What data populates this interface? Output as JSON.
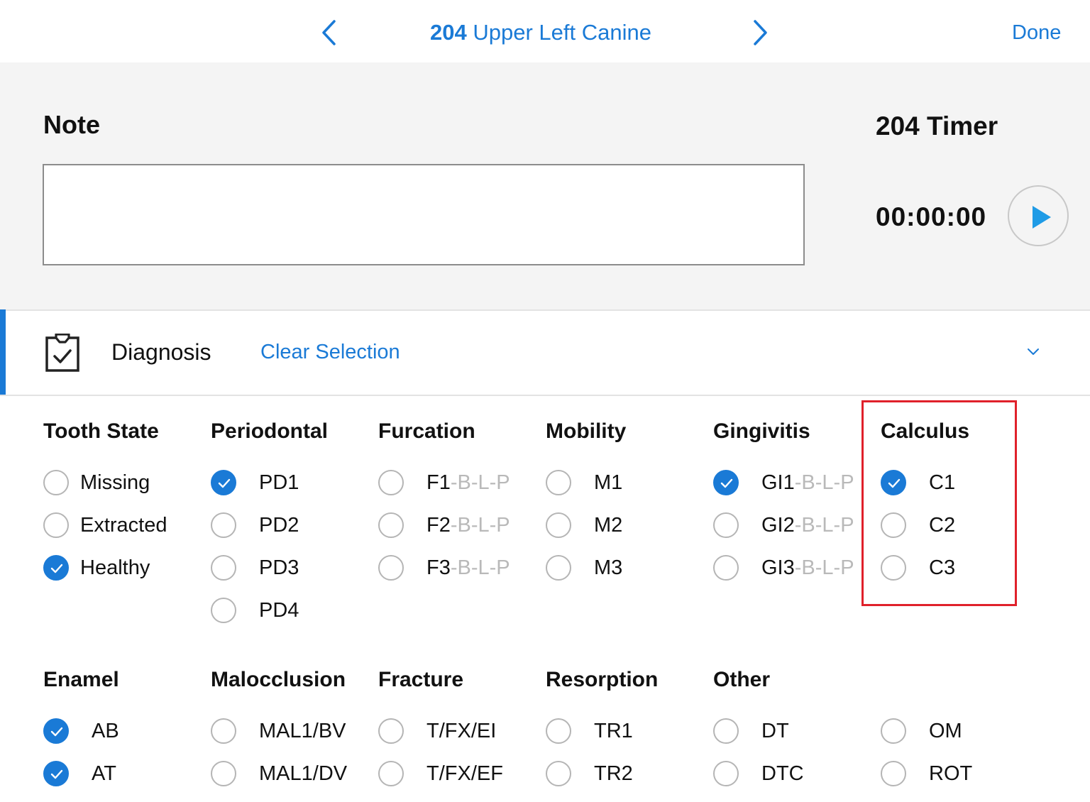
{
  "header": {
    "tooth_number": "204",
    "tooth_name": "Upper Left Canine",
    "done_label": "Done"
  },
  "note": {
    "label": "Note",
    "value": ""
  },
  "timer": {
    "label": "204 Timer",
    "value": "00:00:00"
  },
  "diagnosis": {
    "label": "Diagnosis",
    "clear_label": "Clear Selection",
    "accent_color": "#1a7ad6"
  },
  "groups": {
    "tooth_state": {
      "title": "Tooth State",
      "options": [
        {
          "label": "Missing",
          "checked": false
        },
        {
          "label": "Extracted",
          "checked": false
        },
        {
          "label": "Healthy",
          "checked": true
        }
      ]
    },
    "periodontal": {
      "title": "Periodontal",
      "options": [
        {
          "label": "PD1",
          "checked": true
        },
        {
          "label": "PD2",
          "checked": false
        },
        {
          "label": "PD3",
          "checked": false
        },
        {
          "label": "PD4",
          "checked": false
        }
      ]
    },
    "furcation": {
      "title": "Furcation",
      "options": [
        {
          "label": "F1",
          "suffix": "-B-L-P",
          "checked": false
        },
        {
          "label": "F2",
          "suffix": "-B-L-P",
          "checked": false
        },
        {
          "label": "F3",
          "suffix": "-B-L-P",
          "checked": false
        }
      ]
    },
    "mobility": {
      "title": "Mobility",
      "options": [
        {
          "label": "M1",
          "checked": false
        },
        {
          "label": "M2",
          "checked": false
        },
        {
          "label": "M3",
          "checked": false
        }
      ]
    },
    "gingivitis": {
      "title": "Gingivitis",
      "options": [
        {
          "label": "GI1",
          "suffix": "-B-L-P",
          "checked": true
        },
        {
          "label": "GI2",
          "suffix": "-B-L-P",
          "checked": false
        },
        {
          "label": "GI3",
          "suffix": "-B-L-P",
          "checked": false
        }
      ]
    },
    "calculus": {
      "title": "Calculus",
      "options": [
        {
          "label": "C1",
          "checked": true
        },
        {
          "label": "C2",
          "checked": false
        },
        {
          "label": "C3",
          "checked": false
        }
      ]
    },
    "enamel": {
      "title": "Enamel",
      "options": [
        {
          "label": "AB",
          "checked": true
        },
        {
          "label": "AT",
          "checked": true
        }
      ]
    },
    "malocclusion": {
      "title": "Malocclusion",
      "options": [
        {
          "label": "MAL1/BV",
          "checked": false
        },
        {
          "label": "MAL1/DV",
          "checked": false
        }
      ]
    },
    "fracture": {
      "title": "Fracture",
      "options": [
        {
          "label": "T/FX/EI",
          "checked": false
        },
        {
          "label": "T/FX/EF",
          "checked": false
        }
      ]
    },
    "resorption": {
      "title": "Resorption",
      "options": [
        {
          "label": "TR1",
          "checked": false
        },
        {
          "label": "TR2",
          "checked": false
        }
      ]
    },
    "other": {
      "title": "Other",
      "options": [
        {
          "label": "DT",
          "checked": false
        },
        {
          "label": "DTC",
          "checked": false
        },
        {
          "label": "OM",
          "checked": false
        },
        {
          "label": "ROT",
          "checked": false
        }
      ]
    }
  },
  "highlight_color": "#e0212b"
}
